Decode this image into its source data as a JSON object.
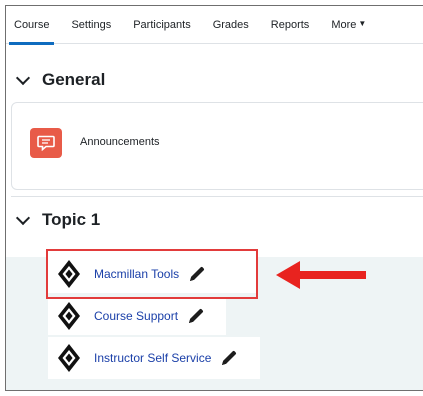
{
  "tabs": [
    {
      "label": "Course",
      "active": true
    },
    {
      "label": "Settings",
      "active": false
    },
    {
      "label": "Participants",
      "active": false
    },
    {
      "label": "Grades",
      "active": false
    },
    {
      "label": "Reports",
      "active": false
    },
    {
      "label": "More",
      "active": false
    }
  ],
  "sections": {
    "general": {
      "title": "General",
      "activities": [
        {
          "name": "Announcements",
          "icon": "forum-icon"
        }
      ]
    },
    "topic1": {
      "title": "Topic 1",
      "activities": [
        {
          "name": "Macmillan Tools",
          "icon": "external-tool-icon",
          "highlighted": true
        },
        {
          "name": "Course Support",
          "icon": "external-tool-icon"
        },
        {
          "name": "Instructor Self Service",
          "icon": "external-tool-icon"
        }
      ]
    }
  },
  "annotation": {
    "box_color": "#e23b3b",
    "arrow_color": "#e8231f",
    "arrow_direction": "left"
  },
  "colors": {
    "accent": "#0f6cbf",
    "link": "#1a3fa8",
    "forum_icon_bg": "#e85b48",
    "activity_bg": "#eef4f5"
  }
}
